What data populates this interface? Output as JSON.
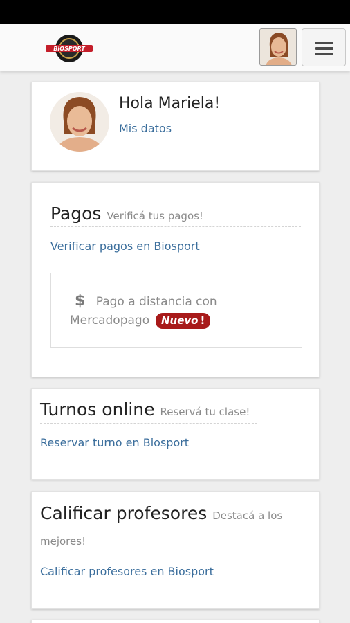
{
  "header": {
    "logo_text": "BIOSPORT",
    "menu_icon": "hamburger-icon"
  },
  "profile": {
    "greeting": "Hola Mariela!",
    "my_data_link": "Mis datos"
  },
  "payments": {
    "title": "Pagos",
    "subtitle": "Verificá tus pagos!",
    "verify_link": "Verificar pagos en Biosport",
    "remote_line1": "Pago a distancia con",
    "remote_line2": "Mercadopago",
    "currency_icon": "$",
    "badge_label": "Nuevo",
    "badge_mark": "!"
  },
  "turns": {
    "title": "Turnos online",
    "subtitle": "Reservá tu clase!",
    "reserve_link": "Reservar turno en Biosport"
  },
  "rate": {
    "title": "Calificar profesores",
    "subtitle_part1": "Destacá a los",
    "subtitle_part2": "mejores!",
    "rate_link": "Calificar profesores en Biosport"
  },
  "colors": {
    "link": "#3b6e9c",
    "badge": "#a81a1a"
  }
}
